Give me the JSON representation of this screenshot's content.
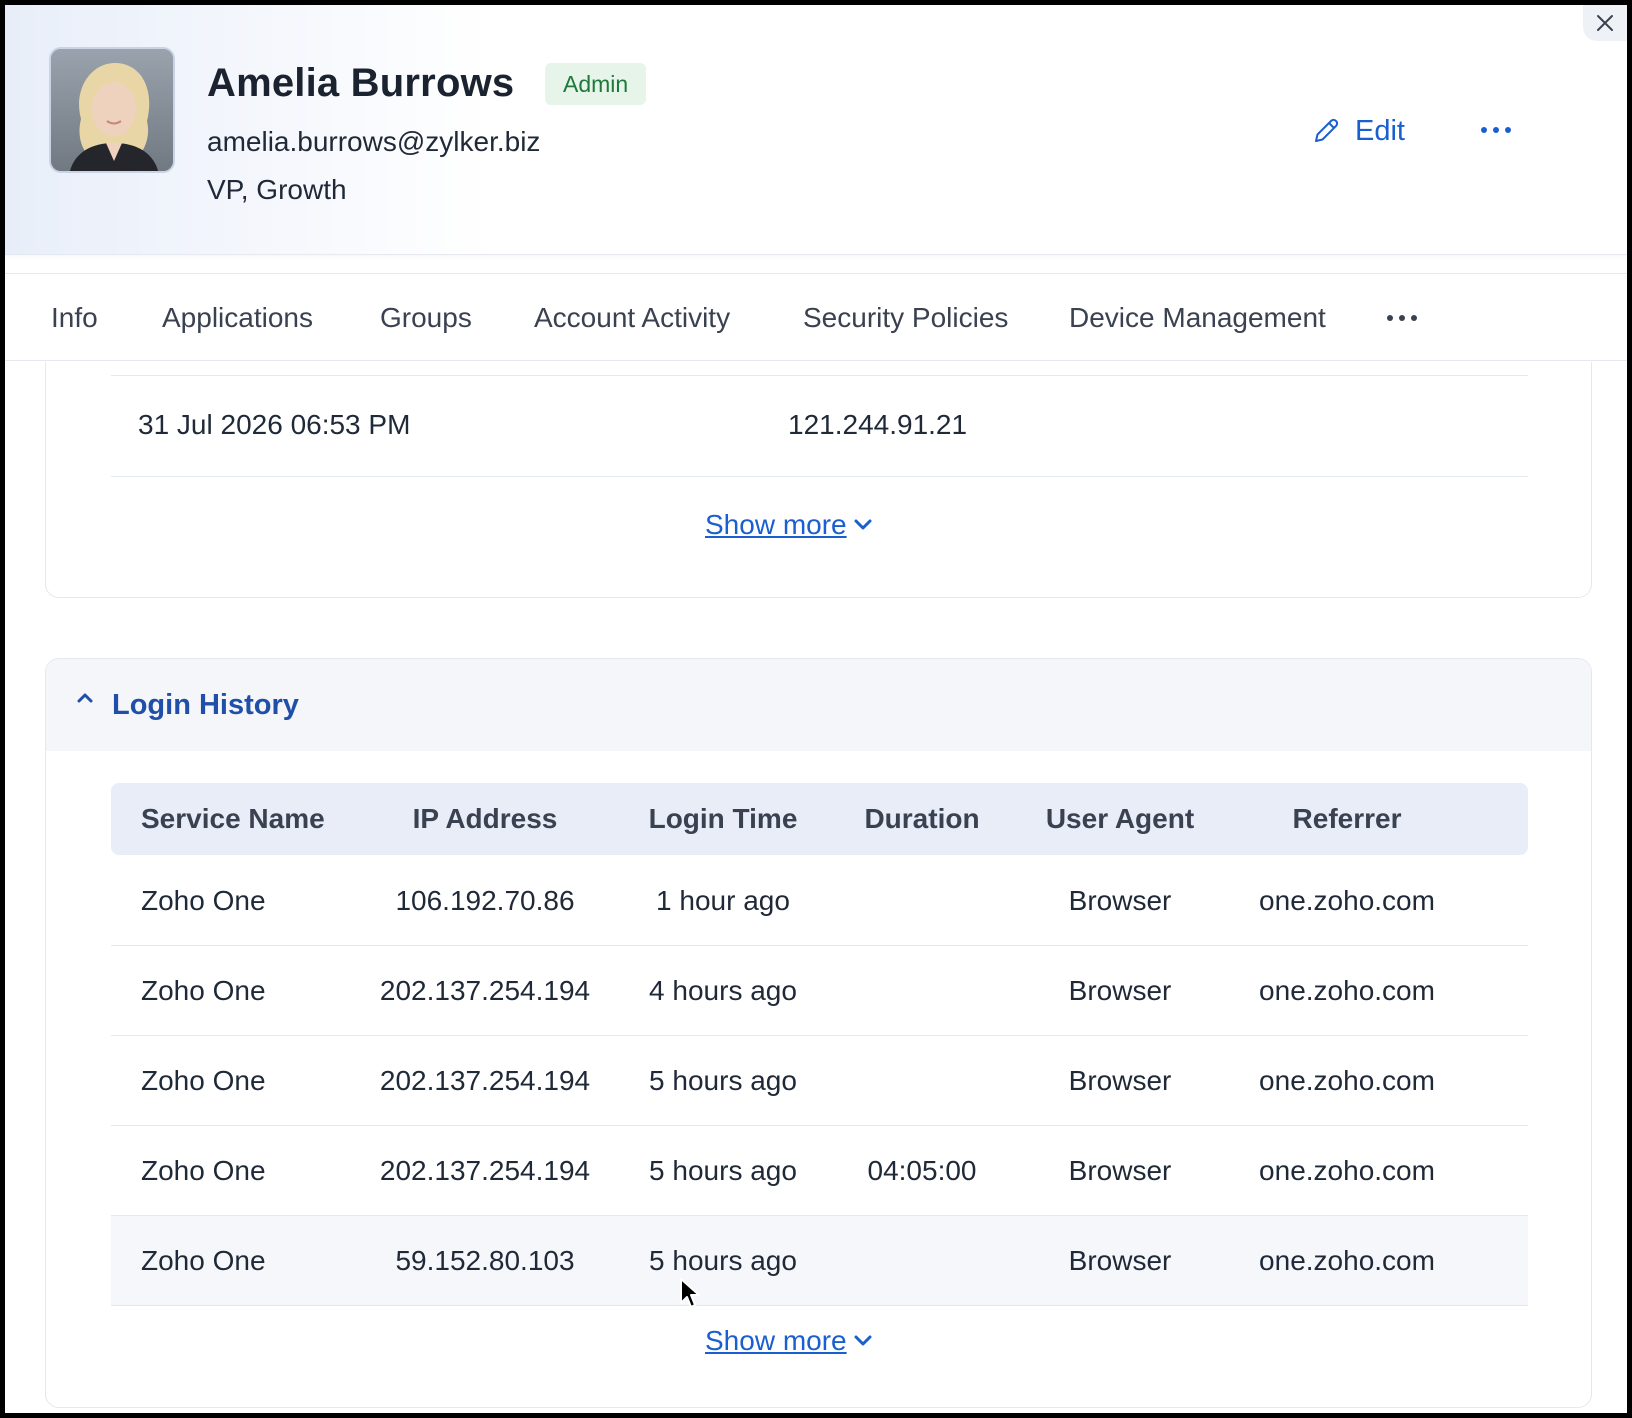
{
  "profile": {
    "name": "Amelia Burrows",
    "role_badge": "Admin",
    "email": "amelia.burrows@zylker.biz",
    "job_title": "VP, Growth",
    "edit_label": "Edit"
  },
  "tabs": [
    "Info",
    "Applications",
    "Groups",
    "Account Activity",
    "Security Policies",
    "Device Management"
  ],
  "previous_section": {
    "row": {
      "time": "31 Jul 2026 06:53 PM",
      "ip": "121.244.91.21"
    },
    "show_more_label": "Show more"
  },
  "login_history": {
    "title": "Login History",
    "columns": [
      "Service Name",
      "IP Address",
      "Login Time",
      "Duration",
      "User Agent",
      "Referrer"
    ],
    "rows": [
      {
        "service": "Zoho One",
        "ip": "106.192.70.86",
        "login_time": "1 hour ago",
        "duration": "",
        "user_agent": "Browser",
        "referrer": "one.zoho.com"
      },
      {
        "service": "Zoho One",
        "ip": "202.137.254.194",
        "login_time": "4 hours ago",
        "duration": "",
        "user_agent": "Browser",
        "referrer": "one.zoho.com"
      },
      {
        "service": "Zoho One",
        "ip": "202.137.254.194",
        "login_time": "5 hours ago",
        "duration": "",
        "user_agent": "Browser",
        "referrer": "one.zoho.com"
      },
      {
        "service": "Zoho One",
        "ip": "202.137.254.194",
        "login_time": "5 hours ago",
        "duration": "04:05:00",
        "user_agent": "Browser",
        "referrer": "one.zoho.com"
      },
      {
        "service": "Zoho One",
        "ip": "59.152.80.103",
        "login_time": "5 hours ago",
        "duration": "",
        "user_agent": "Browser",
        "referrer": "one.zoho.com"
      }
    ],
    "show_more_label": "Show more"
  },
  "colors": {
    "accent": "#1a5fd0",
    "badge_bg": "#e6f4ea",
    "badge_text": "#1d7a3a",
    "section_title": "#1f4fa8",
    "table_header_bg": "#e8edf7"
  },
  "icons": {
    "close": "close-icon",
    "edit": "pencil-icon",
    "more": "more-horizontal-icon",
    "collapse": "chevron-up-icon",
    "show_more": "chevron-down-icon"
  }
}
